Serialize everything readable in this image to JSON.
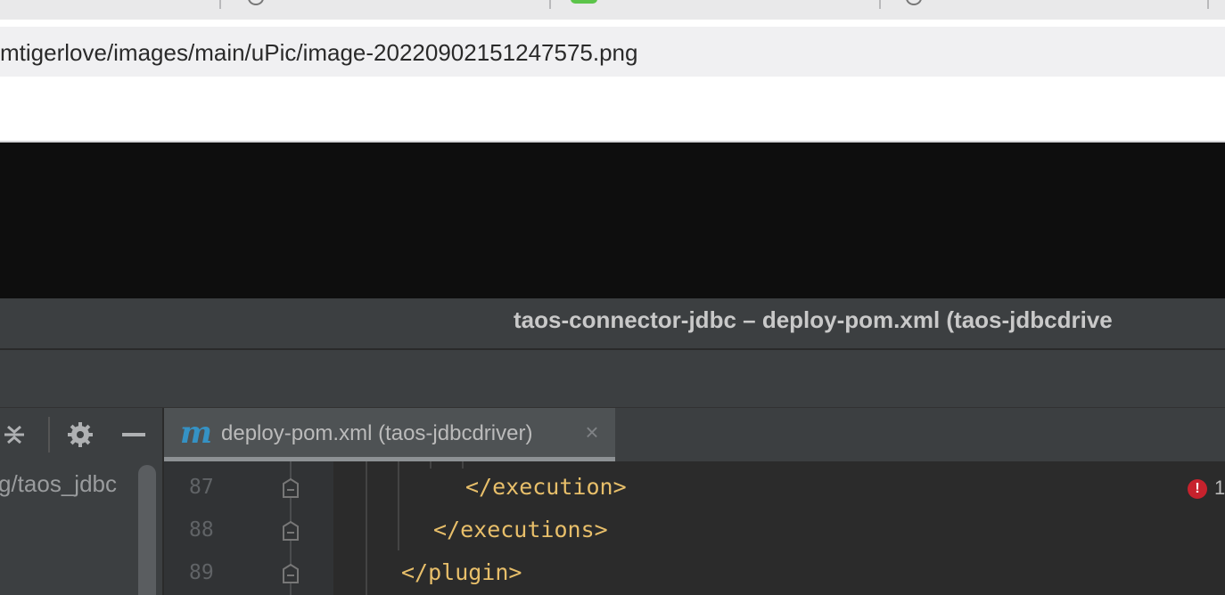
{
  "browser": {
    "address_url": "mtigerlove/images/main/uPic/image-20220902151247575.png"
  },
  "ide": {
    "window_title": "taos-connector-jdbc – deploy-pom.xml (taos-jdbcdrive",
    "editor_tab": {
      "icon_letter": "m",
      "label": "deploy-pom.xml (taos-jdbcdriver)",
      "close_glyph": "×"
    },
    "project_path": "g/taos_jdbc",
    "toolbar_icons": [
      "collapse-all-icon",
      "gear-icon",
      "minimize-icon"
    ],
    "inspection": {
      "error_glyph": "!",
      "error_count": "1"
    },
    "code": {
      "line_numbers": [
        "87",
        "88",
        "89"
      ],
      "lines": [
        "</execution>",
        "</executions>",
        "</plugin>"
      ]
    },
    "colors": {
      "xml_tag": "#e8bf6a",
      "editor_bg": "#2b2b2b",
      "gutter_bg": "#313335",
      "error_red": "#c7222d",
      "maven_icon_blue": "#3592c4"
    }
  }
}
